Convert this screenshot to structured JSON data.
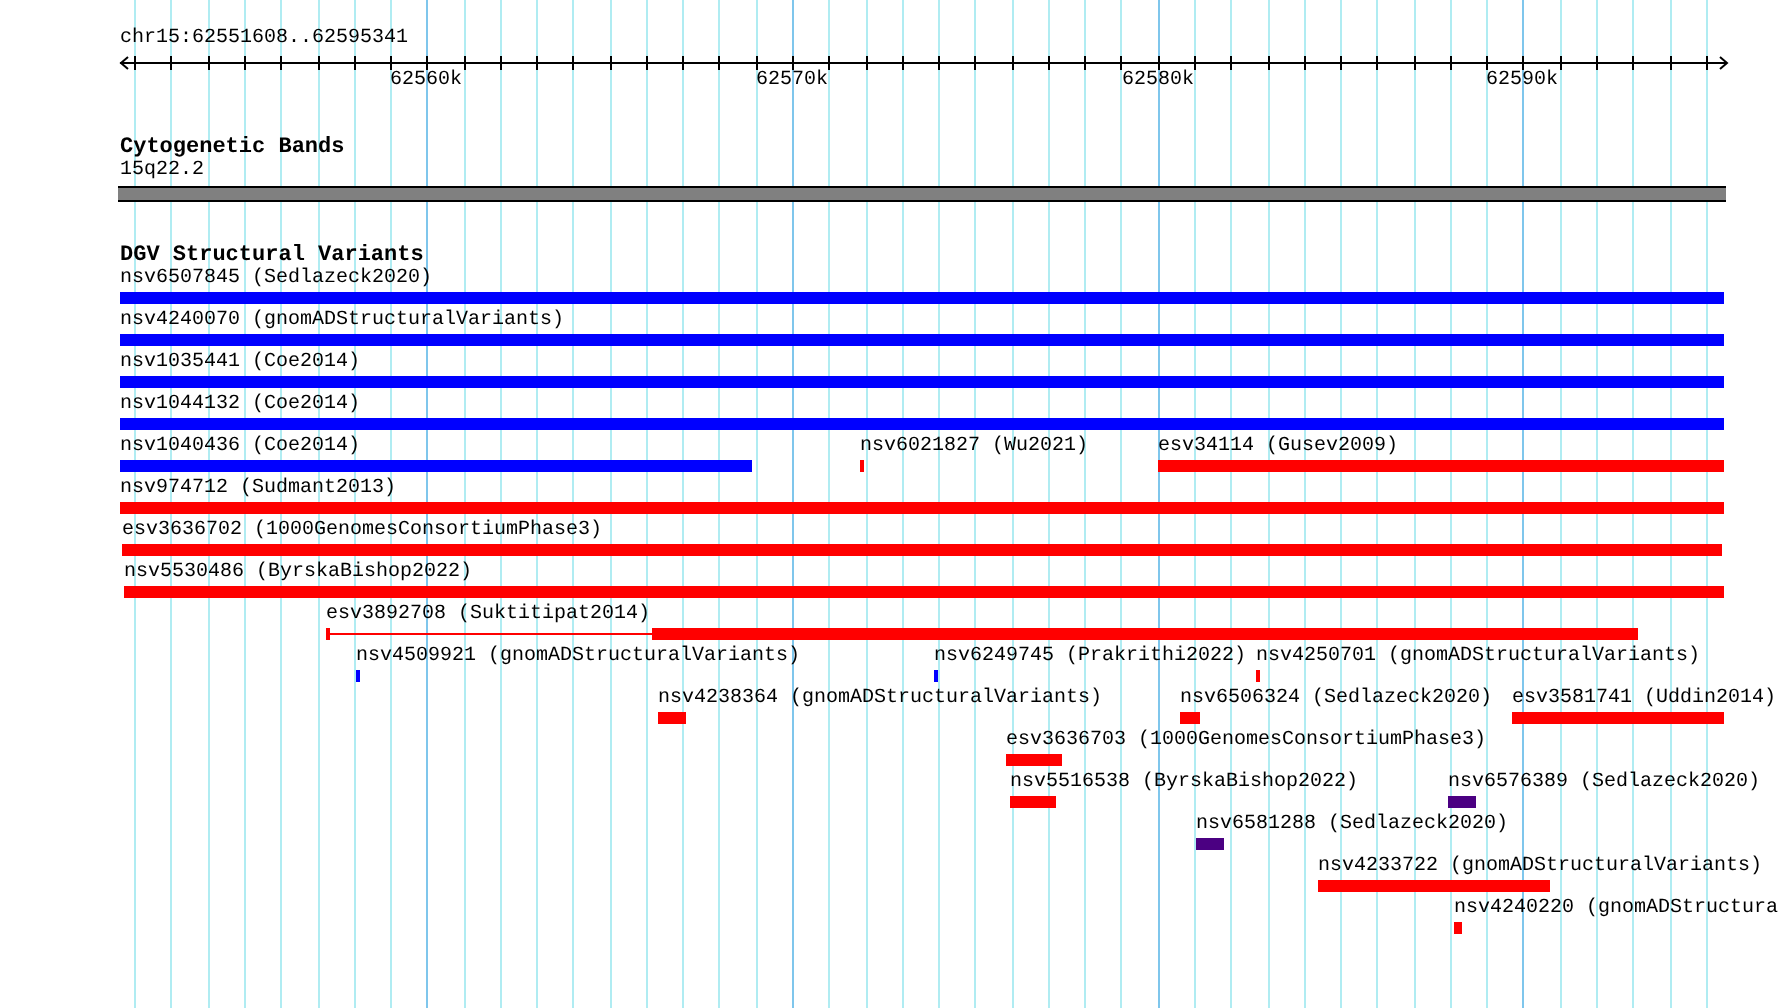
{
  "ruler": {
    "location": "chr15:62551608..62595341",
    "tick_labels": [
      "62560k",
      "62570k",
      "62580k",
      "62590k"
    ]
  },
  "cytogenetic_track": {
    "title": "Cytogenetic Bands",
    "band": {
      "label": "15q22.2",
      "color": "#808080"
    }
  },
  "variant_track": {
    "title": "DGV Structural Variants",
    "rows": [
      [
        {
          "label": "nsv6507845 (Sedlazeck2020)",
          "color": "#0000ff",
          "kind": "solid"
        }
      ],
      [
        {
          "label": "nsv4240070 (gnomADStructuralVariants)",
          "color": "#0000ff",
          "kind": "solid"
        }
      ],
      [
        {
          "label": "nsv1035441 (Coe2014)",
          "color": "#0000ff",
          "kind": "solid"
        }
      ],
      [
        {
          "label": "nsv1044132 (Coe2014)",
          "color": "#0000ff",
          "kind": "solid"
        }
      ],
      [
        {
          "label": "nsv1040436 (Coe2014)",
          "color": "#0000ff",
          "kind": "solid"
        },
        {
          "label": "nsv6021827 (Wu2021)",
          "color": "#ff0000",
          "kind": "solid"
        },
        {
          "label": "esv34114 (Gusev2009)",
          "color": "#ff0000",
          "kind": "solid"
        }
      ],
      [
        {
          "label": "nsv974712 (Sudmant2013)",
          "color": "#ff0000",
          "kind": "solid"
        }
      ],
      [
        {
          "label": "esv3636702 (1000GenomesConsortiumPhase3)",
          "color": "#ff0000",
          "kind": "solid"
        }
      ],
      [
        {
          "label": "nsv5530486 (ByrskaBishop2022)",
          "color": "#ff0000",
          "kind": "solid"
        }
      ],
      [
        {
          "label": "esv3892708 (Suktitipat2014)",
          "color": "#ff0000",
          "kind": "split"
        }
      ],
      [
        {
          "label": "nsv4509921 (gnomADStructuralVariants)",
          "color": "#0000ff",
          "kind": "solid"
        },
        {
          "label": "nsv6249745 (Prakrithi2022)",
          "color": "#0000ff",
          "kind": "solid"
        },
        {
          "label": "nsv4250701 (gnomADStructuralVariants)",
          "color": "#ff0000",
          "kind": "solid"
        }
      ],
      [
        {
          "label": "nsv4238364 (gnomADStructuralVariants)",
          "color": "#ff0000",
          "kind": "solid"
        },
        {
          "label": "nsv6506324 (Sedlazeck2020)",
          "color": "#ff0000",
          "kind": "solid"
        },
        {
          "label": "esv3581741 (Uddin2014)",
          "color": "#ff0000",
          "kind": "solid"
        }
      ],
      [
        {
          "label": "esv3636703 (1000GenomesConsortiumPhase3)",
          "color": "#ff0000",
          "kind": "solid"
        }
      ],
      [
        {
          "label": "nsv5516538 (ByrskaBishop2022)",
          "color": "#ff0000",
          "kind": "solid"
        },
        {
          "label": "nsv6576389 (Sedlazeck2020)",
          "color": "#4b0082",
          "kind": "solid"
        }
      ],
      [
        {
          "label": "nsv6581288 (Sedlazeck2020)",
          "color": "#4b0082",
          "kind": "solid"
        }
      ],
      [
        {
          "label": "nsv4233722 (gnomADStructuralVariants)",
          "color": "#ff0000",
          "kind": "solid"
        }
      ],
      [
        {
          "label": "nsv4240220 (gnomADStructura",
          "color": "#ff0000",
          "kind": "solid"
        }
      ]
    ]
  }
}
